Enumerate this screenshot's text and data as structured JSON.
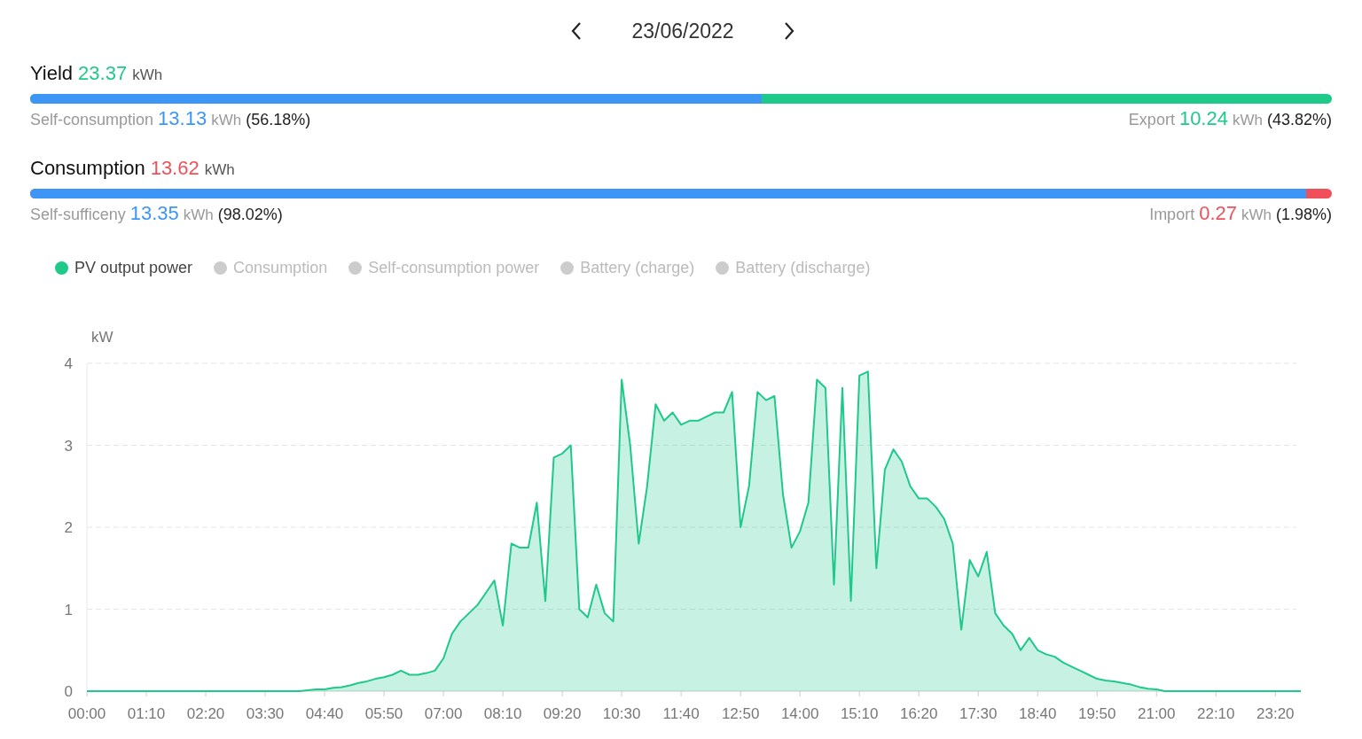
{
  "date_nav": {
    "date": "23/06/2022"
  },
  "summaries": [
    {
      "kind": "yield",
      "title": "Yield",
      "value": "23.37",
      "unit": "kWh",
      "level": 0.5618,
      "left": {
        "label": "Self-consumption",
        "value": "13.13",
        "unit": "kWh",
        "percent": "(56.18%)"
      },
      "right": {
        "label": "Export",
        "value": "10.24",
        "unit": "kWh",
        "percent": "(43.82%)"
      }
    },
    {
      "kind": "consumption",
      "title": "Consumption",
      "value": "13.62",
      "unit": "kWh",
      "level": 0.9802,
      "left": {
        "label": "Self-sufficeny",
        "value": "13.35",
        "unit": "kWh",
        "percent": "(98.02%)"
      },
      "right": {
        "label": "Import",
        "value": "0.27",
        "unit": "kWh",
        "percent": "(1.98%)"
      }
    }
  ],
  "chart": {
    "legend": [
      {
        "label": "PV output power",
        "on": true
      },
      {
        "label": "Consumption",
        "on": false
      },
      {
        "label": "Self-consumption power",
        "on": false
      },
      {
        "label": "Battery (charge)",
        "on": false
      },
      {
        "label": "Battery (discharge)",
        "on": false
      }
    ],
    "chart_data": {
      "type": "area",
      "grid": true,
      "ylabel": "kW",
      "xlim": [
        0,
        1430
      ],
      "ylim": [
        0,
        4
      ],
      "yticks": [
        0,
        1,
        2,
        3,
        4
      ],
      "xticks": [
        {
          "value": 0,
          "label": "00:00"
        },
        {
          "value": 70,
          "label": "01:10"
        },
        {
          "value": 140,
          "label": "02:20"
        },
        {
          "value": 210,
          "label": "03:30"
        },
        {
          "value": 280,
          "label": "04:40"
        },
        {
          "value": 350,
          "label": "05:50"
        },
        {
          "value": 420,
          "label": "07:00"
        },
        {
          "value": 490,
          "label": "08:10"
        },
        {
          "value": 560,
          "label": "09:20"
        },
        {
          "value": 630,
          "label": "10:30"
        },
        {
          "value": 700,
          "label": "11:40"
        },
        {
          "value": 770,
          "label": "12:50"
        },
        {
          "value": 840,
          "label": "14:00"
        },
        {
          "value": 910,
          "label": "15:10"
        },
        {
          "value": 980,
          "label": "16:20"
        },
        {
          "value": 1050,
          "label": "17:30"
        },
        {
          "value": 1120,
          "label": "18:40"
        },
        {
          "value": 1190,
          "label": "19:50"
        },
        {
          "value": 1260,
          "label": "21:00"
        },
        {
          "value": 1330,
          "label": "22:10"
        },
        {
          "value": 1400,
          "label": "23:20"
        }
      ],
      "x": [
        0,
        10,
        20,
        30,
        40,
        50,
        60,
        70,
        80,
        90,
        100,
        110,
        120,
        130,
        140,
        150,
        160,
        170,
        180,
        190,
        200,
        210,
        220,
        230,
        240,
        250,
        260,
        270,
        280,
        290,
        300,
        310,
        320,
        330,
        340,
        350,
        360,
        370,
        380,
        390,
        400,
        410,
        420,
        430,
        440,
        450,
        460,
        470,
        480,
        490,
        500,
        510,
        520,
        530,
        540,
        550,
        560,
        570,
        580,
        590,
        600,
        610,
        620,
        630,
        640,
        650,
        660,
        670,
        680,
        690,
        700,
        710,
        720,
        730,
        740,
        750,
        760,
        770,
        780,
        790,
        800,
        810,
        820,
        830,
        840,
        850,
        860,
        870,
        880,
        890,
        900,
        910,
        920,
        930,
        940,
        950,
        960,
        970,
        980,
        990,
        1000,
        1010,
        1020,
        1030,
        1040,
        1050,
        1060,
        1070,
        1080,
        1090,
        1100,
        1110,
        1120,
        1130,
        1140,
        1150,
        1160,
        1170,
        1180,
        1190,
        1200,
        1210,
        1220,
        1230,
        1240,
        1250,
        1260,
        1270,
        1280,
        1290,
        1300,
        1310,
        1320,
        1330,
        1340,
        1350,
        1360,
        1370,
        1380,
        1390,
        1400,
        1410,
        1420,
        1430
      ],
      "series": [
        {
          "color": "#1ec98a",
          "values": [
            0,
            0,
            0,
            0,
            0,
            0,
            0,
            0,
            0,
            0,
            0,
            0,
            0,
            0,
            0,
            0,
            0,
            0,
            0,
            0,
            0,
            0,
            0,
            0,
            0,
            0,
            0.01,
            0.02,
            0.02,
            0.04,
            0.05,
            0.07,
            0.1,
            0.12,
            0.15,
            0.17,
            0.2,
            0.25,
            0.2,
            0.2,
            0.22,
            0.25,
            0.4,
            0.7,
            0.85,
            0.95,
            1.05,
            1.2,
            1.35,
            0.8,
            1.8,
            1.75,
            1.75,
            2.3,
            1.1,
            2.85,
            2.9,
            3.0,
            1.0,
            0.9,
            1.3,
            0.95,
            0.85,
            3.8,
            3.0,
            1.8,
            2.5,
            3.5,
            3.3,
            3.4,
            3.25,
            3.3,
            3.3,
            3.35,
            3.4,
            3.4,
            3.65,
            2.0,
            2.5,
            3.65,
            3.55,
            3.6,
            2.4,
            1.75,
            1.95,
            2.3,
            3.8,
            3.7,
            1.3,
            3.7,
            1.1,
            3.85,
            3.9,
            1.5,
            2.7,
            2.95,
            2.8,
            2.5,
            2.35,
            2.35,
            2.25,
            2.1,
            1.8,
            0.75,
            1.6,
            1.4,
            1.7,
            0.95,
            0.8,
            0.7,
            0.5,
            0.65,
            0.5,
            0.45,
            0.42,
            0.35,
            0.3,
            0.25,
            0.2,
            0.15,
            0.13,
            0.12,
            0.1,
            0.08,
            0.05,
            0.03,
            0.02,
            0,
            0,
            0,
            0,
            0,
            0,
            0,
            0,
            0,
            0,
            0,
            0,
            0,
            0,
            0,
            0,
            0
          ]
        }
      ]
    }
  }
}
